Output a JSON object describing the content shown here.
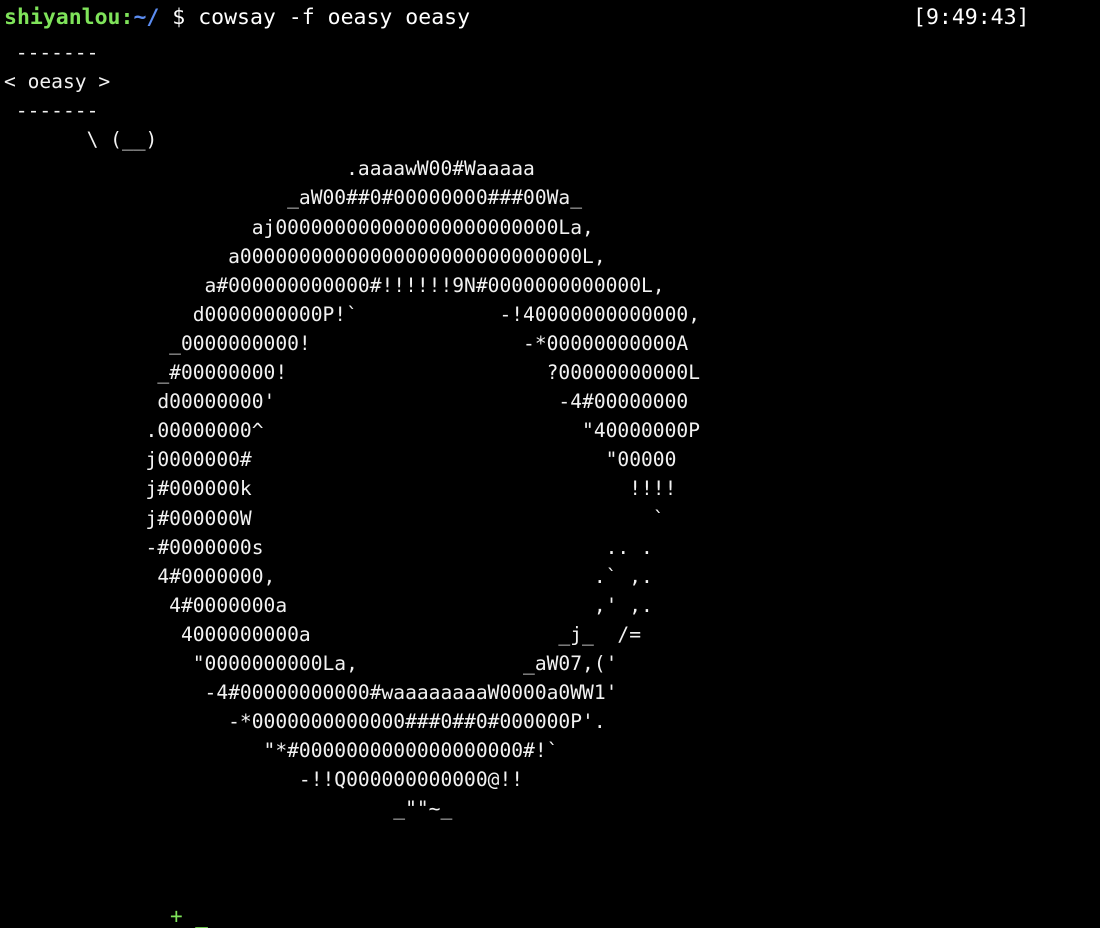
{
  "terminal": {
    "prompt": {
      "user": "shiyanlou",
      "separator": ":",
      "path": "~/",
      "symbol": "$",
      "command": "cowsay -f oeasy oeasy"
    },
    "timestamp": "[9:49:43]",
    "output_lines": [
      " -------",
      "< oeasy >",
      " -------",
      "       \\ (__)",
      "                             .aaaawW00#Waaaaa",
      "                        _aW00##0#00000000###00Wa_",
      "                     aj000000000000000000000000La,",
      "                   a00000000000000000000000000000L,",
      "                 a#000000000000#!!!!!!9N#0000000000000L,",
      "                d0000000000P!`            -!40000000000000,",
      "              _0000000000!                  -*00000000000A",
      "             _#00000000!                      ?00000000000L",
      "             d00000000'                        -4#00000000",
      "            .00000000^                           \"40000000P",
      "            j0000000#                              \"00000",
      "            j#000000k                                !!!!",
      "            j#000000W                                  `",
      "            -#0000000s                             .. .",
      "             4#0000000,                           .` ,.",
      "              4#0000000a                          ,' ,.",
      "               4000000000a                     _j_  /=",
      "                \"0000000000La,              _aW07,('",
      "                 -4#00000000000#waaaaaaaaW0000a0WW1'",
      "                   -*0000000000000###0##0#000000P'.",
      "                      \"*#0000000000000000000#!`",
      "                         -!!Q000000000000@!!",
      "                                 _\"\"~_"
    ],
    "next_prompt_fragment": "+ _"
  }
}
